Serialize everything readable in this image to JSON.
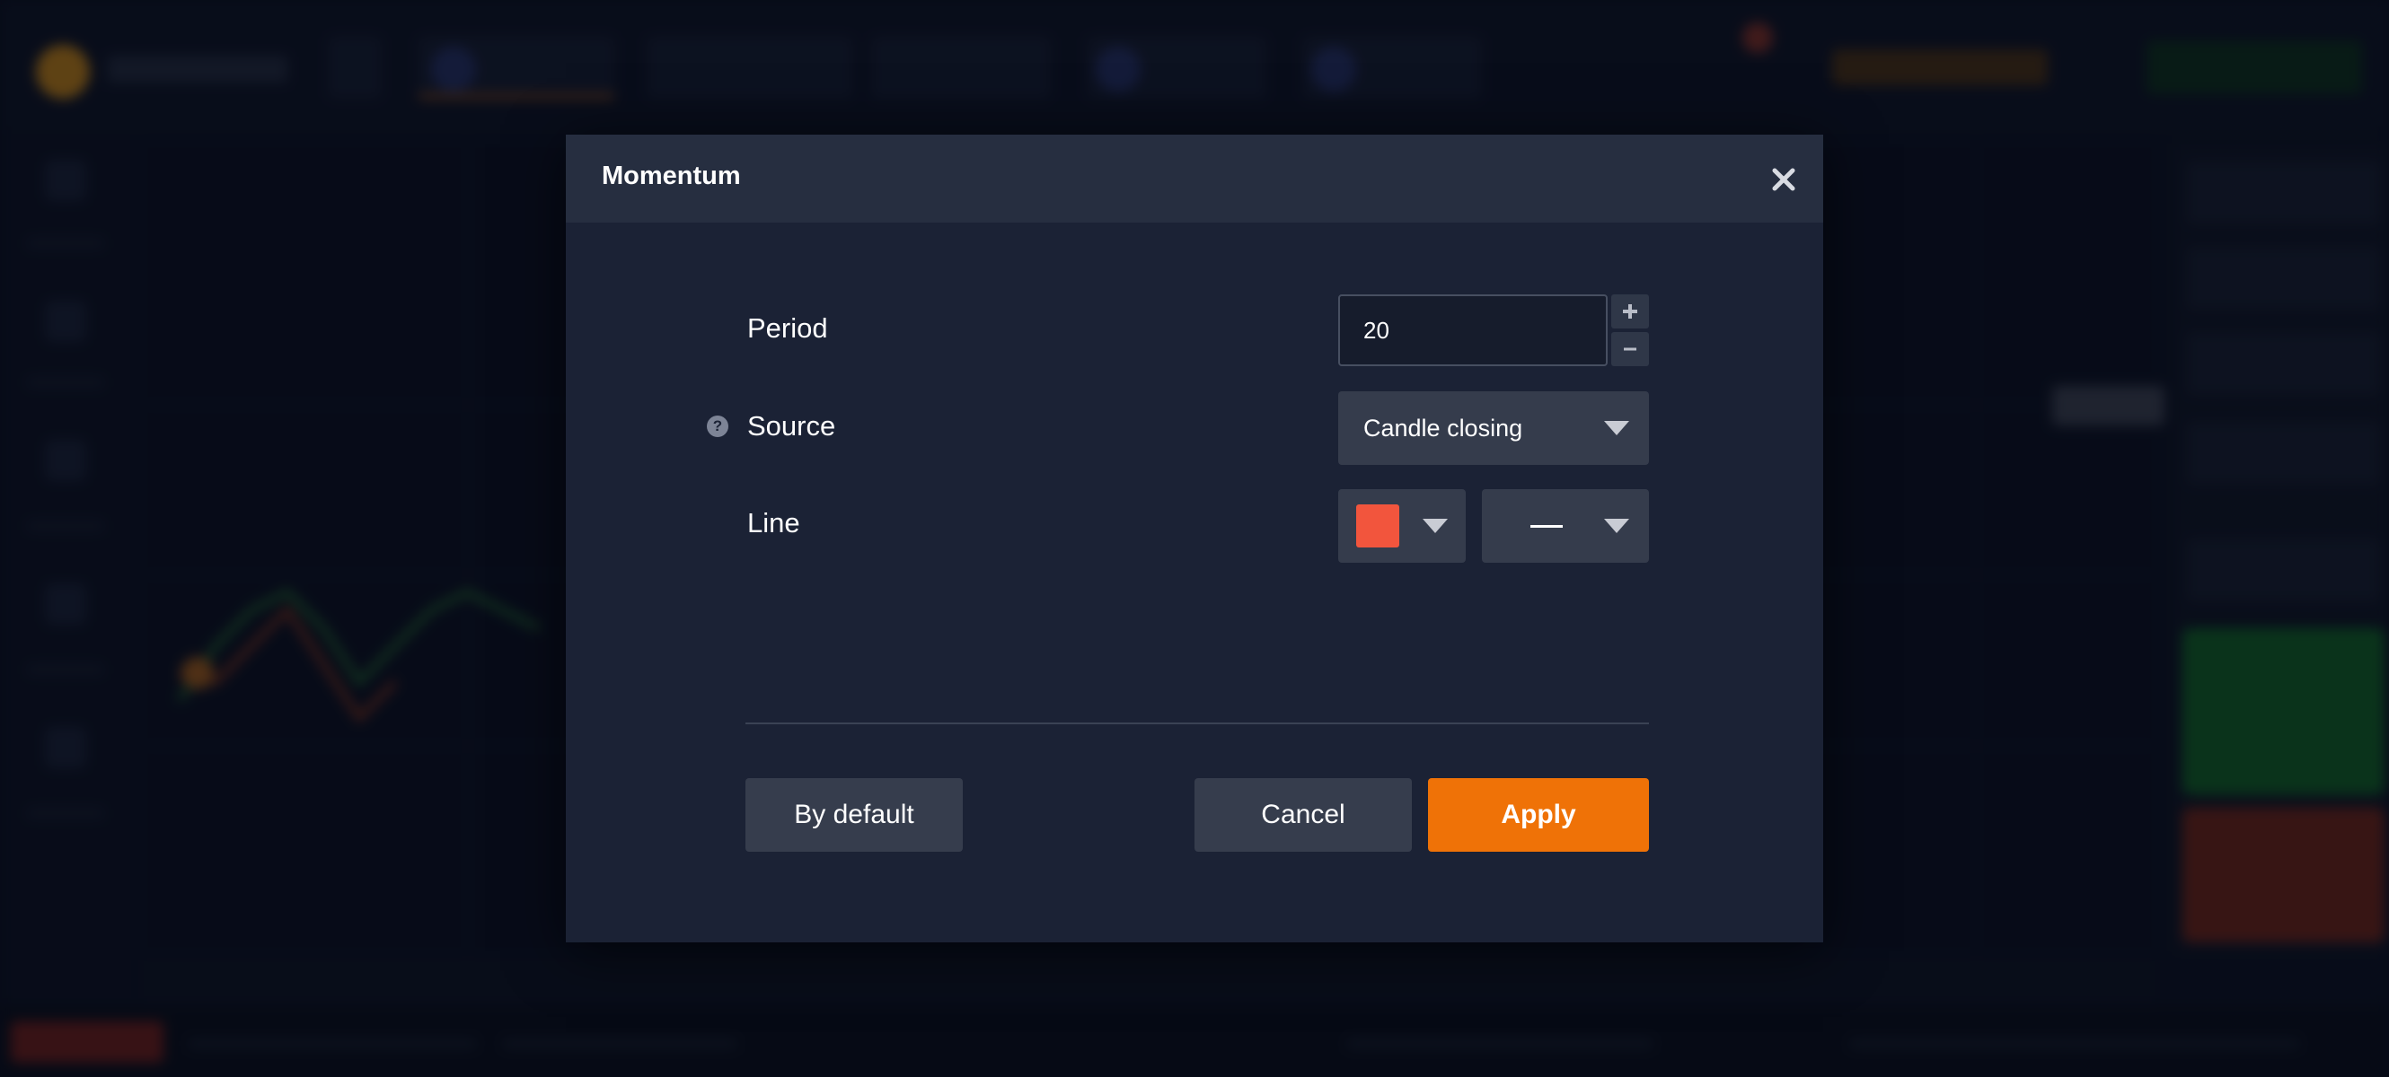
{
  "modal": {
    "title": "Momentum",
    "close_icon": "close-icon"
  },
  "fields": {
    "period": {
      "label": "Period",
      "value": "20",
      "increment_icon": "plus-icon",
      "decrement_icon": "minus-icon"
    },
    "source": {
      "label": "Source",
      "help_icon": "help-icon",
      "selected": "Candle closing",
      "caret_icon": "chevron-down-icon"
    },
    "line": {
      "label": "Line",
      "color": "#f2553d",
      "style_icon": "solid-line-icon",
      "caret_icon": "chevron-down-icon"
    }
  },
  "buttons": {
    "by_default": "By default",
    "cancel": "Cancel",
    "apply": "Apply"
  },
  "colors": {
    "accent": "#ef7207",
    "modal_bg": "#1b2235",
    "header_bg": "#262e40",
    "control_bg": "#353c4c",
    "line_color": "#f2553d"
  }
}
